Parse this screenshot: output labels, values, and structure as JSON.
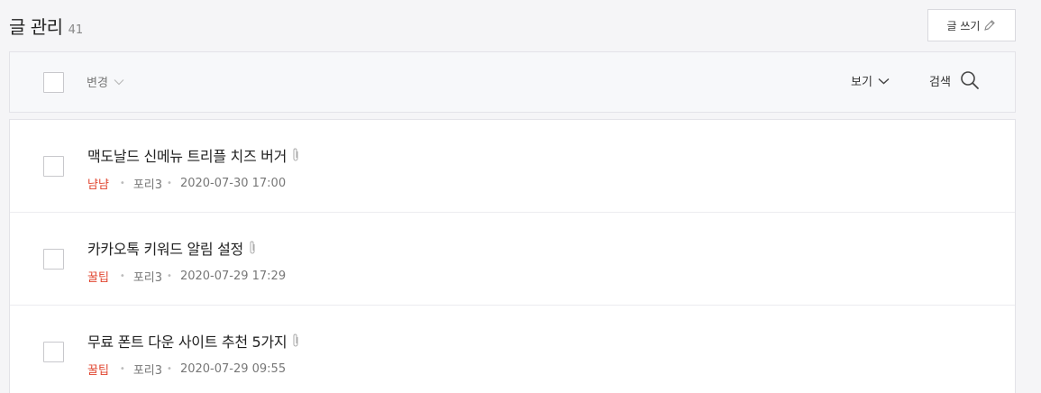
{
  "header": {
    "title": "글 관리",
    "count": "41",
    "write_label": "글 쓰기"
  },
  "toolbar": {
    "change_label": "변경",
    "view_label": "보기",
    "search_label": "검색"
  },
  "posts": [
    {
      "title": "맥도날드 신메뉴 트리플 치즈 버거",
      "category": "냠냠",
      "author": "포리3",
      "date": "2020-07-30 17:00"
    },
    {
      "title": "카카오톡 키워드 알림 설정",
      "category": "꿀팁",
      "author": "포리3",
      "date": "2020-07-29 17:29"
    },
    {
      "title": "무료 폰트 다운 사이트 추천 5가지",
      "category": "꿀팁",
      "author": "포리3",
      "date": "2020-07-29 09:55"
    }
  ],
  "icons": {
    "write": "pencil-icon",
    "change": "chevron-down-icon",
    "view": "chevron-down-icon",
    "search": "search-icon",
    "attachment": "paperclip-icon"
  },
  "colors": {
    "category": "#e0452f",
    "background": "#f5f5f7"
  }
}
